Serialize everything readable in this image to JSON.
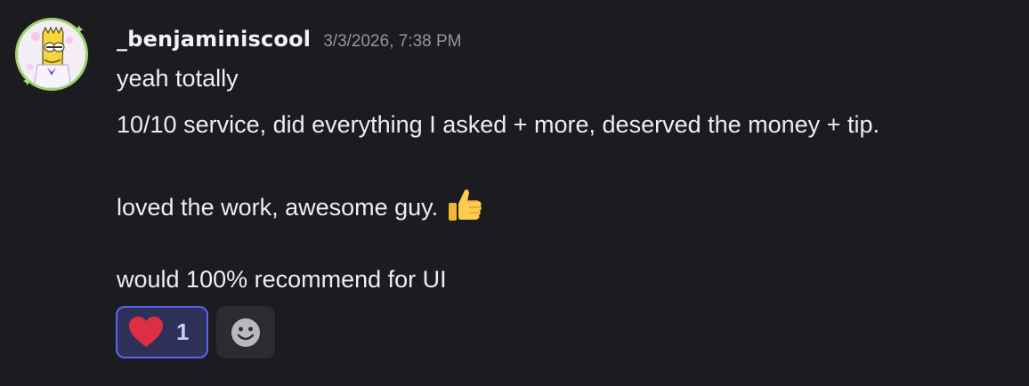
{
  "message": {
    "username": "_benjaminiscool",
    "timestamp": "3/3/2026, 7:38 PM",
    "lines": [
      "yeah totally",
      "10/10 service, did everything I asked + more, deserved the money + tip.",
      "loved the work, awesome guy.",
      "would 100% recommend for UI"
    ],
    "emoji": "thumbs-up-icon"
  },
  "reactions": [
    {
      "icon": "heart-icon",
      "count": "1",
      "active": true,
      "accent": "#5865f2",
      "color": "#dd2e44"
    },
    {
      "icon": "add-reaction-icon",
      "active": false
    }
  ],
  "colors": {
    "background": "#1b1b20",
    "username": "#f2f3f5",
    "timestamp": "#94959c",
    "avatar_ring": "#9fd36a"
  }
}
